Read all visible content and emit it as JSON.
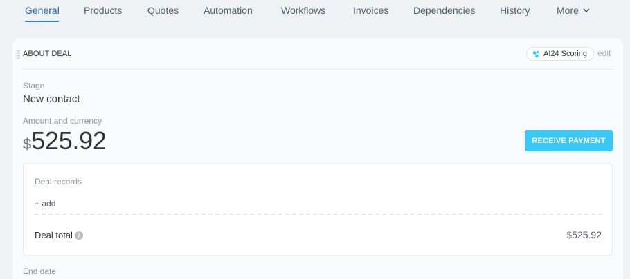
{
  "tabs": [
    {
      "label": "General",
      "active": true
    },
    {
      "label": "Products"
    },
    {
      "label": "Quotes"
    },
    {
      "label": "Automation"
    },
    {
      "label": "Workflows"
    },
    {
      "label": "Invoices"
    },
    {
      "label": "Dependencies"
    },
    {
      "label": "History"
    },
    {
      "label": "More"
    }
  ],
  "section": {
    "title": "ABOUT DEAL",
    "ai_badge": "AI24 Scoring",
    "edit": "edit"
  },
  "stage": {
    "label": "Stage",
    "value": "New contact"
  },
  "amount": {
    "label": "Amount and currency",
    "currency_symbol": "$",
    "value": "525.92"
  },
  "receive_payment": "RECEIVE PAYMENT",
  "records": {
    "title": "Deal records",
    "add": "+ add",
    "total_label": "Deal total",
    "total_currency": "$",
    "total_value": "525.92"
  },
  "end_date": {
    "label": "End date"
  },
  "colors": {
    "accent": "#2f7ed8",
    "button": "#3bc8f5"
  }
}
